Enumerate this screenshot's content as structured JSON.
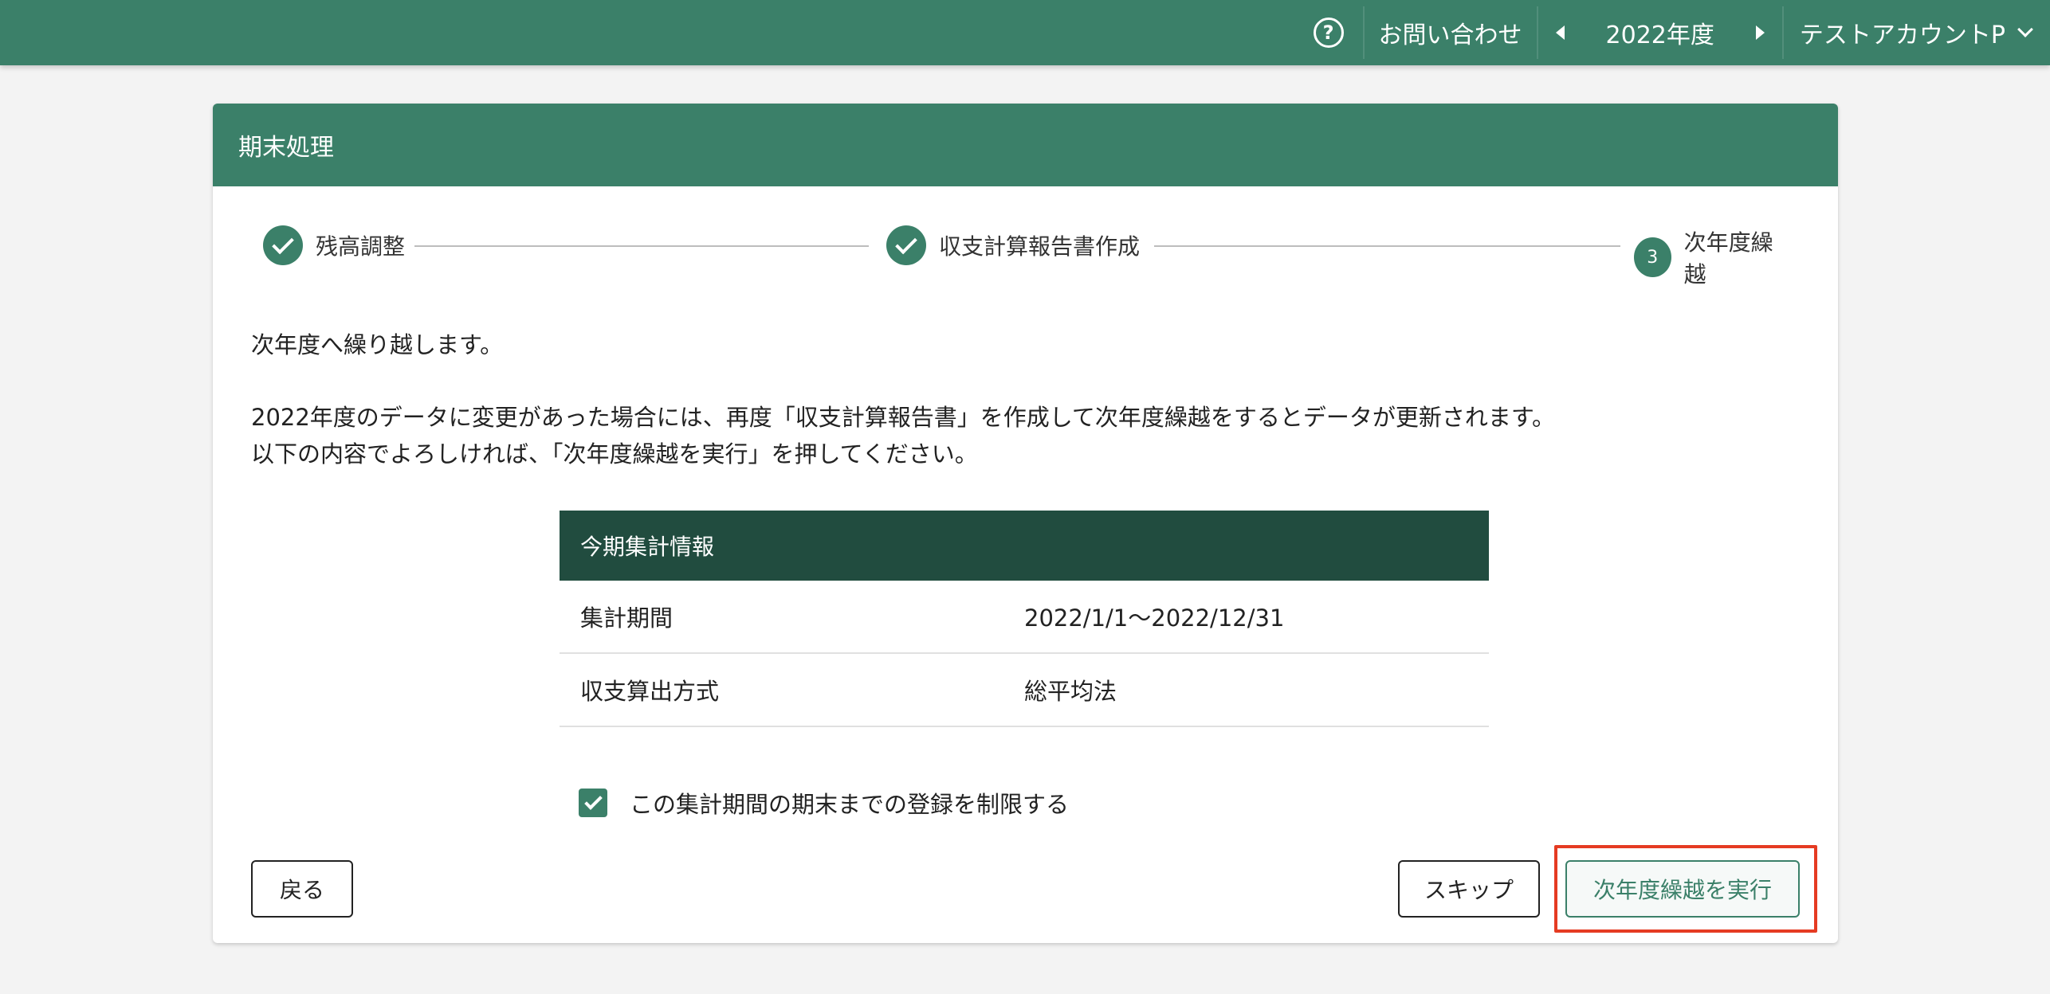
{
  "topbar": {
    "help_icon_glyph": "?",
    "contact_label": "お問い合わせ",
    "year_label": "2022年度",
    "account_label": "テストアカウントP"
  },
  "card": {
    "title": "期末処理"
  },
  "stepper": {
    "steps": [
      {
        "label": "残高調整",
        "state": "completed"
      },
      {
        "label": "収支計算報告書作成",
        "state": "completed"
      },
      {
        "label": "次年度繰越",
        "state": "active",
        "number": "3"
      }
    ]
  },
  "content": {
    "line1": "次年度へ繰り越します。",
    "line2": "2022年度のデータに変更があった場合には、再度「収支計算報告書」を作成して次年度繰越をするとデータが更新されます。",
    "line3": "以下の内容でよろしければ、「次年度繰越を実行」を押してください。"
  },
  "info_table": {
    "header": "今期集計情報",
    "rows": [
      {
        "key": "集計期間",
        "value": "2022/1/1〜2022/12/31"
      },
      {
        "key": "収支算出方式",
        "value": "総平均法"
      }
    ]
  },
  "restrict_checkbox": {
    "label": "この集計期間の期末までの登録を制限する",
    "checked": true
  },
  "buttons": {
    "back": "戻る",
    "skip": "スキップ",
    "execute": "次年度繰越を実行"
  },
  "colors": {
    "primary": "#3b8069",
    "table_header": "#214c3f",
    "highlight": "#e53b22"
  }
}
